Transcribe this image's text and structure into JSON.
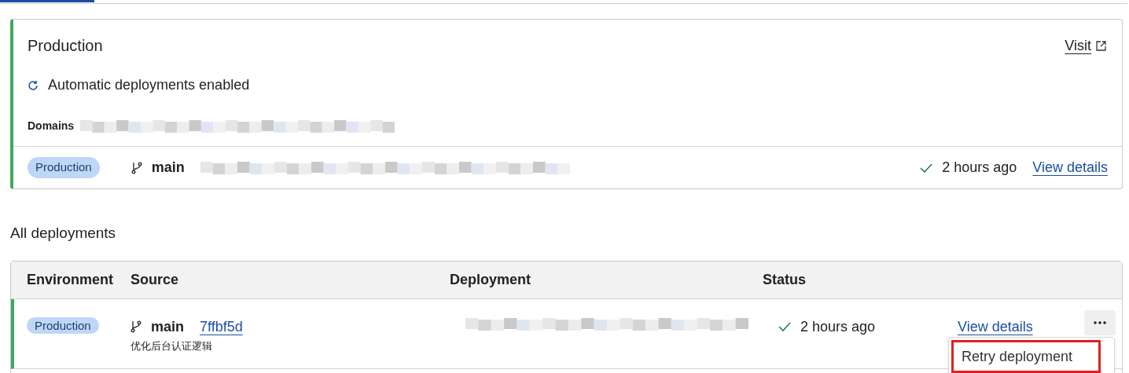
{
  "production": {
    "title": "Production",
    "visit": "Visit",
    "auto_deploy": "Automatic deployments enabled",
    "domains_label": "Domains",
    "environment": "Production",
    "branch": "main",
    "time": "2 hours ago",
    "view_details": "View details"
  },
  "section_title": "All deployments",
  "table": {
    "columns": [
      "Environment",
      "Source",
      "Deployment",
      "Status"
    ],
    "rows": [
      {
        "environment": "Production",
        "branch": "main",
        "commit": "7ffbf5d",
        "message": "优化后台认证逻辑",
        "time": "2 hours ago",
        "view_details": "View details"
      }
    ]
  },
  "menu": {
    "items": [
      {
        "label": "Retry deployment",
        "highlighted": true
      }
    ]
  }
}
